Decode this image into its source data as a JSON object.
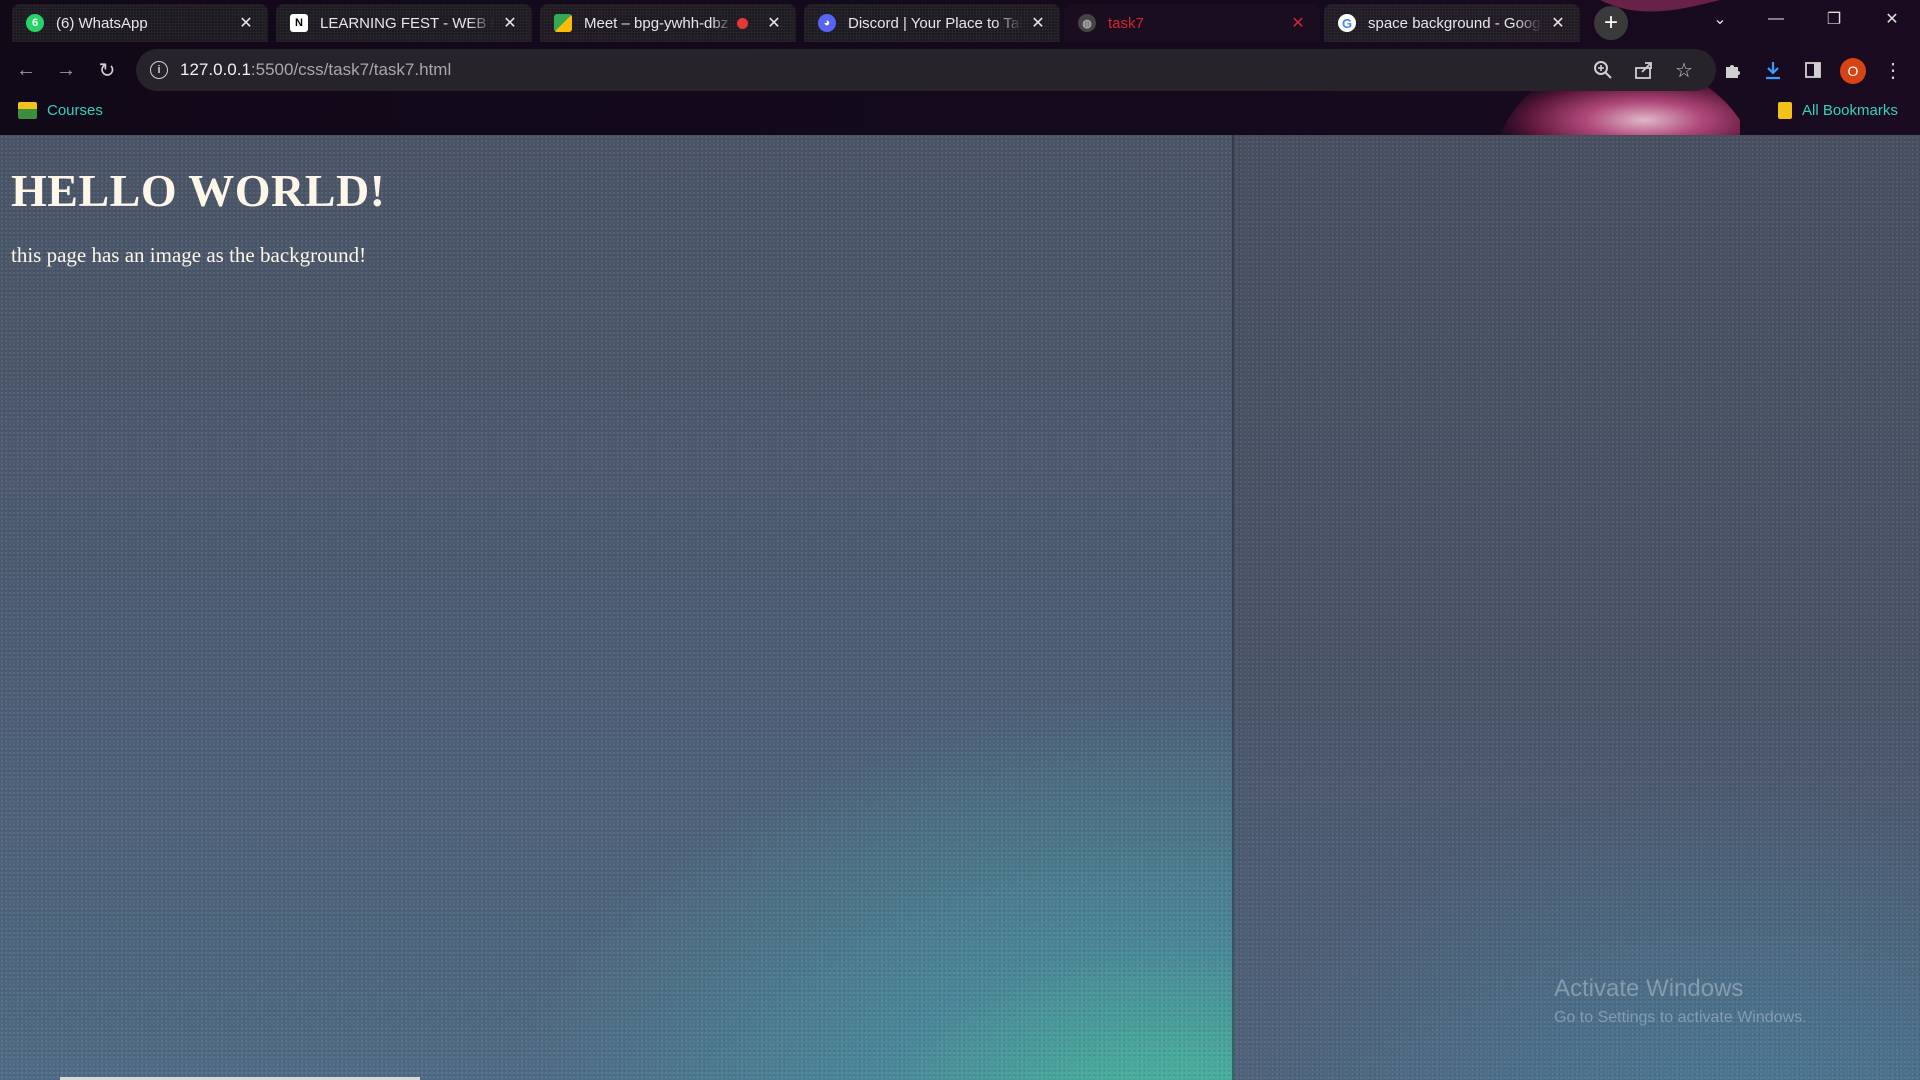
{
  "browser": {
    "tabs": [
      {
        "title": "(6) WhatsApp",
        "icon": "whatsapp-icon",
        "active": false
      },
      {
        "title": "LEARNING FEST - WEB DE",
        "icon": "notion-icon",
        "active": false
      },
      {
        "title": "Meet – bpg-ywhh-dbz",
        "icon": "google-meet-icon",
        "active": false,
        "recording": true
      },
      {
        "title": "Discord | Your Place to Talk",
        "icon": "discord-icon",
        "active": false
      },
      {
        "title": "task7",
        "icon": "globe-icon",
        "active": true
      },
      {
        "title": "space background - Google",
        "icon": "google-icon",
        "active": false
      }
    ],
    "address": {
      "host": "127.0.0.1",
      "path": ":5500/css/task7/task7.html"
    },
    "bookmarks": {
      "left": "Courses",
      "right": "All Bookmarks"
    },
    "profile_initial": "O",
    "accent_color": "#35d0b8"
  },
  "page": {
    "heading": "HELLO WORLD!",
    "paragraph": "this page has an image as the background!"
  },
  "watermark": {
    "line1": "Activate Windows",
    "line2": "Go to Settings to activate Windows."
  }
}
